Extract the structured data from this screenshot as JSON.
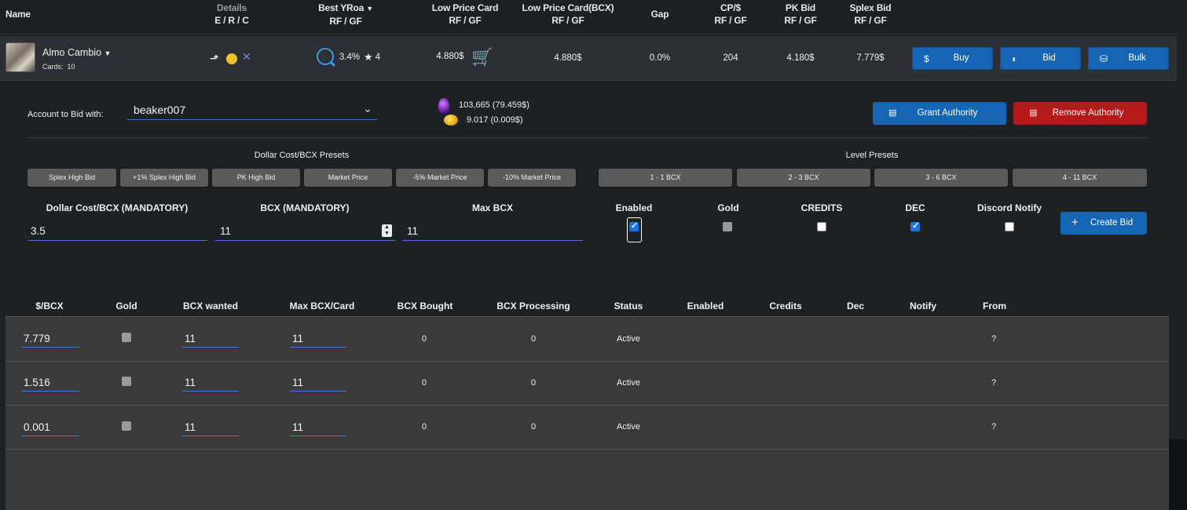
{
  "header": {
    "name": "Name",
    "details": "Details",
    "details_sub": "E / R / C",
    "best_yroa": "Best YRoa",
    "best_yroa_sub": "RF / GF",
    "low_price": "Low Price Card",
    "low_price_sub": "RF / GF",
    "low_price_bcx": "Low Price Card(BCX)",
    "low_price_bcx_sub": "RF / GF",
    "gap": "Gap",
    "cp": "CP/$",
    "cp_sub": "RF / GF",
    "pk_bid": "PK Bid",
    "pk_bid_sub": "RF / GF",
    "splex_bid": "Splex Bid",
    "splex_bid_sub": "RF / GF"
  },
  "card": {
    "name": "Almo Cambio",
    "cards_label": "Cards:",
    "cards_count": "10",
    "yroa": "3.4%",
    "stars": "4",
    "low_price": "4.880$",
    "low_price_bcx": "4.880$",
    "gap": "0.0%",
    "cp": "204",
    "pk_bid": "4.180$",
    "splex_bid": "7.779$",
    "buy_label": "Buy",
    "bid_label": "Bid",
    "bulk_label": "Bulk"
  },
  "bid_form": {
    "account_label": "Account to Bid with:",
    "account_value": "beaker007",
    "balance_1": "103,665 (79.459$)",
    "balance_2": "9.017 (0.009$)",
    "grant_label": "Grant Authority",
    "remove_label": "Remove Authority",
    "dollar_presets_title": "Dollar Cost/BCX Presets",
    "dollar_presets": [
      "Splex High Bid",
      "+1% Splex High Bid",
      "PK High Bid",
      "Market Price",
      "-5% Market Price",
      "-10% Market Price"
    ],
    "level_presets_title": "Level Presets",
    "level_presets": [
      "1 - 1 BCX",
      "2 - 3 BCX",
      "3 - 6 BCX",
      "4 - 11 BCX"
    ],
    "dollar_cost_label": "Dollar Cost/BCX (MANDATORY)",
    "dollar_cost_value": "3.5",
    "bcx_label": "BCX (MANDATORY)",
    "bcx_value": "11",
    "max_bcx_label": "Max BCX",
    "max_bcx_value": "11",
    "enabled_label": "Enabled",
    "gold_label": "Gold",
    "credits_label": "CREDITS",
    "dec_label": "DEC",
    "discord_label": "Discord Notify",
    "enabled_checked": true,
    "gold_checked": false,
    "credits_checked": false,
    "dec_checked": true,
    "discord_checked": false,
    "create_label": "Create Bid"
  },
  "bids_table": {
    "columns": [
      "$/BCX",
      "Gold",
      "BCX wanted",
      "Max BCX/Card",
      "BCX Bought",
      "BCX Processing",
      "Status",
      "Enabled",
      "Credits",
      "Dec",
      "Notify",
      "From"
    ],
    "rows": [
      {
        "price": "7.779",
        "bcx_wanted": "11",
        "max_bcx": "11",
        "bought": "0",
        "processing": "0",
        "status": "Active",
        "from": "?"
      },
      {
        "price": "1.516",
        "bcx_wanted": "11",
        "max_bcx": "11",
        "bought": "0",
        "processing": "0",
        "status": "Active",
        "from": "?"
      },
      {
        "price": "0.001",
        "bcx_wanted": "11",
        "max_bcx": "11",
        "bought": "0",
        "processing": "0",
        "status": "Active",
        "from": "?"
      }
    ]
  },
  "colors": {
    "accent_blue": "#1664b4",
    "danger_red": "#b51a1a",
    "icon_blue": "#3a9be8",
    "bg": "#1e2124",
    "table_bg": "#3a3a3a"
  }
}
